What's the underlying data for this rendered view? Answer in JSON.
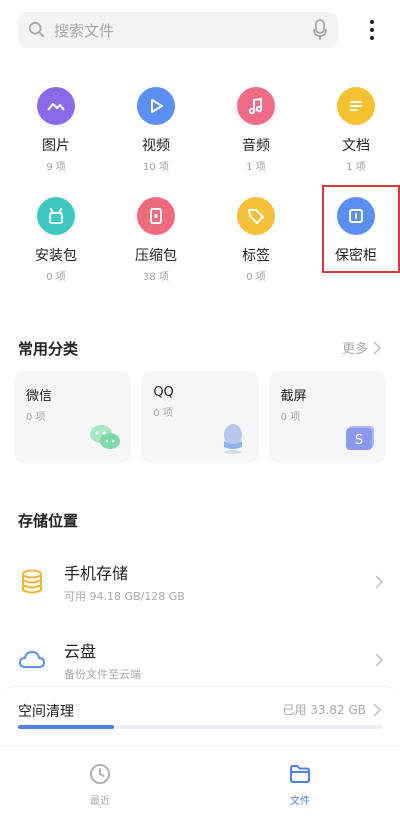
{
  "search": {
    "placeholder": "搜索文件"
  },
  "categories": [
    {
      "name": "图片",
      "count": "9 项",
      "color": "#8a6ae6",
      "icon": "image-icon"
    },
    {
      "name": "视频",
      "count": "10 项",
      "color": "#5c8ff2",
      "icon": "play-icon"
    },
    {
      "name": "音频",
      "count": "1 项",
      "color": "#ef6b86",
      "icon": "music-icon"
    },
    {
      "name": "文档",
      "count": "1 项",
      "color": "#f5c232",
      "icon": "document-icon"
    },
    {
      "name": "安装包",
      "count": "0 项",
      "color": "#3ec8c0",
      "icon": "android-icon"
    },
    {
      "name": "压缩包",
      "count": "38 项",
      "color": "#ef6b7b",
      "icon": "archive-icon"
    },
    {
      "name": "标签",
      "count": "0 项",
      "color": "#f5bf3a",
      "icon": "tag-icon"
    },
    {
      "name": "保密柜",
      "color": "#5c8ff2",
      "icon": "safe-icon"
    }
  ],
  "frequent": {
    "title": "常用分类",
    "more": "更多",
    "items": [
      {
        "name": "微信",
        "count": "0 项",
        "icon": "wechat-icon"
      },
      {
        "name": "QQ",
        "count": "0 项",
        "icon": "qq-icon"
      },
      {
        "name": "截屏",
        "count": "0 项",
        "icon": "screenshot-icon"
      }
    ]
  },
  "storage": {
    "title": "存储位置",
    "items": [
      {
        "name": "手机存储",
        "sub": "可用 94.18 GB/128 GB",
        "icon": "database-icon"
      },
      {
        "name": "云盘",
        "sub": "备份文件至云端",
        "icon": "cloud-icon"
      }
    ]
  },
  "cleanup": {
    "title": "空间清理",
    "used": "已用 33.82 GB",
    "used_fraction": 0.264
  },
  "nav": [
    {
      "label": "最近",
      "icon": "clock-icon",
      "active": false
    },
    {
      "label": "文件",
      "icon": "folder-icon",
      "active": true
    }
  ],
  "colors": {
    "accent": "#4c80f0",
    "highlight_border": "#d63a3a"
  }
}
